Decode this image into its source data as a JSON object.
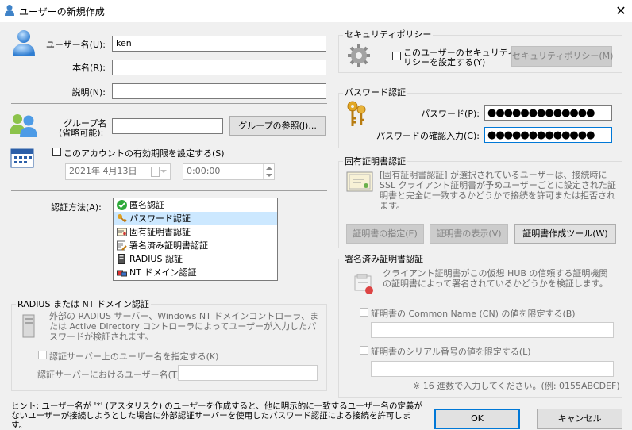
{
  "window": {
    "title": "ユーザーの新規作成",
    "close": "✕"
  },
  "user": {
    "username_label": "ユーザー名(U):",
    "username_value": "ken",
    "realname_label": "本名(R):",
    "realname_value": "",
    "desc_label": "説明(N):",
    "desc_value": ""
  },
  "group": {
    "label_line1": "グループ名",
    "label_line2": "(省略可能):",
    "value": "",
    "browse_button": "グループの参照(J)..."
  },
  "expiry": {
    "checkbox_label": "このアカウントの有効期限を設定する(S)",
    "date": "2021年 4月13日",
    "time": "0:00:00"
  },
  "auth": {
    "label": "認証方法(A):",
    "methods": [
      "匿名認証",
      "パスワード認証",
      "固有証明書認証",
      "署名済み証明書認証",
      "RADIUS 認証",
      "NT ドメイン認証"
    ],
    "selected": "パスワード認証"
  },
  "radius": {
    "title": "RADIUS または NT ドメイン認証",
    "desc": "外部の RADIUS サーバー、Windows NT ドメインコントローラ、または Active Directory コントローラによってユーザーが入力したパスワードが検証されます。",
    "checkbox_label": "認証サーバー上のユーザー名を指定する(K)",
    "server_user_label": "認証サーバーにおけるユーザー名(T):",
    "server_user_value": ""
  },
  "hint": "ヒント: ユーザー名が '*' (アスタリスク) のユーザーを作成すると、他に明示的に一致するユーザー名の定義がないユーザーが接続しようとした場合に外部認証サーバーを使用したパスワード認証による接続を許可します。",
  "security": {
    "title": "セキュリティポリシー",
    "checkbox_label_line1": "このユーザーのセキュリティポ",
    "checkbox_label_line2": "リシーを設定する(Y)",
    "button": "セキュリティポリシー(M)"
  },
  "password": {
    "title": "パスワード認証",
    "password_label": "パスワード(P):",
    "password_value": "●●●●●●●●●●●●●",
    "confirm_label": "パスワードの確認入力(C):",
    "confirm_value": "●●●●●●●●●●●●●"
  },
  "cert": {
    "title": "固有証明書認証",
    "desc": "[固有証明書認証] が選択されているユーザーは、接続時に SSL クライアント証明書が予めユーザーごとに設定された証明書と完全に一致するかどうかで接続を許可または拒否されます。",
    "specify_button": "証明書の指定(E)",
    "view_button": "証明書の表示(V)",
    "tool_button": "証明書作成ツール(W)"
  },
  "signed": {
    "title": "署名済み証明書認証",
    "desc": "クライアント証明書がこの仮想 HUB の信頼する証明機関の証明書によって署名されているかどうかを検証します。",
    "cn_checkbox": "証明書の Common Name (CN) の値を限定する(B)",
    "cn_value": "",
    "serial_checkbox": "証明書のシリアル番号の値を限定する(L)",
    "serial_value": "",
    "serial_note": "※ 16 進数で入力してください。(例: 0155ABCDEF)"
  },
  "footer": {
    "ok_button": "OK",
    "cancel_button": "キャンセル"
  },
  "colors": {
    "accent": "#0078d7",
    "selection": "#cce8ff",
    "disabled_text": "#6d6d6d"
  }
}
